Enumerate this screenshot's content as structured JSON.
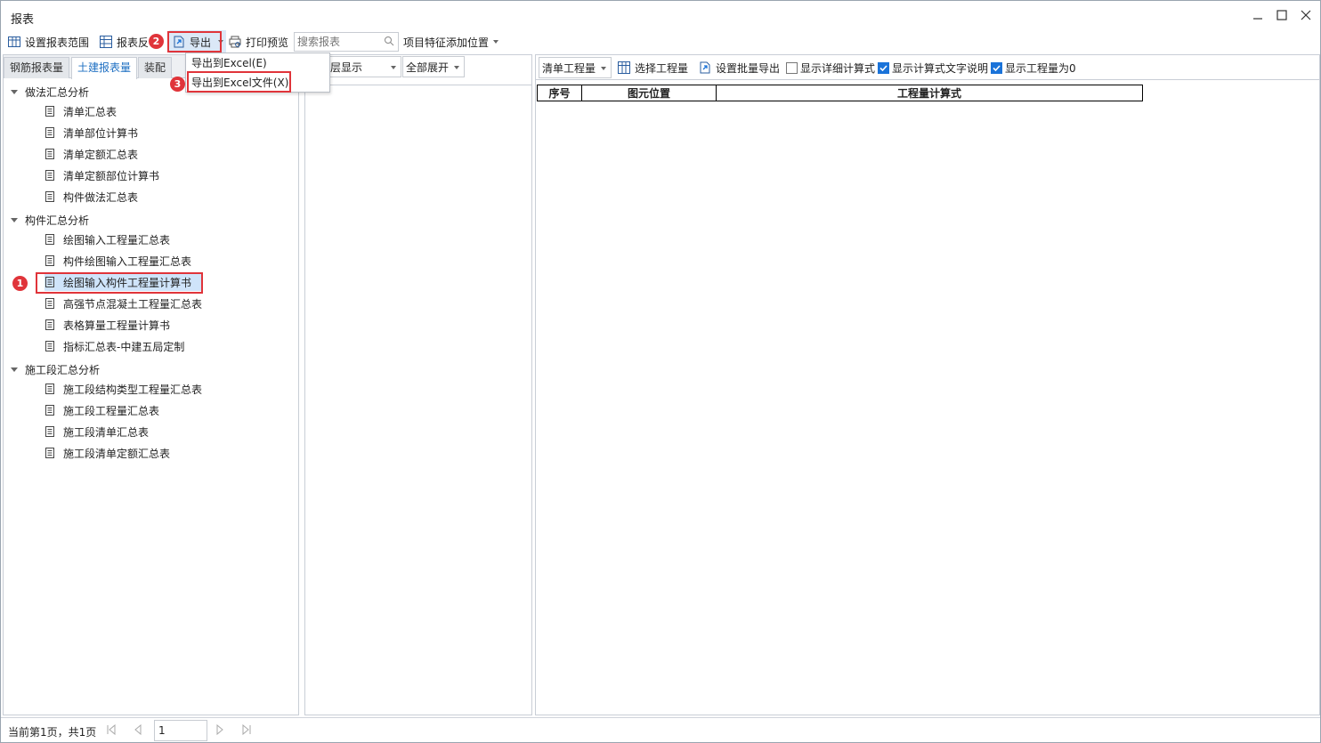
{
  "window": {
    "title": "报表"
  },
  "toolbar": {
    "set_range_label": "设置报表范围",
    "report_reverse_label": "报表反",
    "export_label": "导出",
    "print_preview_label": "打印预览",
    "search_placeholder": "搜索报表",
    "add_feature_label": "项目特征添加位置"
  },
  "export_menu": {
    "items": [
      "导出到Excel(E)",
      "导出到Excel文件(X)"
    ]
  },
  "badges": {
    "b1": "1",
    "b2": "2",
    "b3": "3"
  },
  "left_tabs": [
    "钢筋报表量",
    "土建报表量",
    "装配"
  ],
  "tree": {
    "groups": [
      {
        "label": "做法汇总分析",
        "items": [
          "清单汇总表",
          "清单部位计算书",
          "清单定额汇总表",
          "清单定额部位计算书",
          "构件做法汇总表"
        ]
      },
      {
        "label": "构件汇总分析",
        "items": [
          "绘图输入工程量汇总表",
          "构件绘图输入工程量汇总表",
          "绘图输入构件工程量计算书",
          "高强节点混凝土工程量汇总表",
          "表格算量工程量计算书",
          "指标汇总表-中建五局定制"
        ]
      },
      {
        "label": "施工段汇总分析",
        "items": [
          "施工段结构类型工程量汇总表",
          "施工段工程量汇总表",
          "施工段清单汇总表",
          "施工段清单定额汇总表"
        ]
      }
    ]
  },
  "middle": {
    "layer_combo": "层显示",
    "expand_combo": "全部展开"
  },
  "right_toolbar": {
    "qty_combo": "清单工程量",
    "select_qty_label": "选择工程量",
    "batch_export_label": "设置批量导出",
    "show_detail_label": "显示详细计算式",
    "show_detail_checked": false,
    "show_text_label": "显示计算式文字说明",
    "show_text_checked": true,
    "show_zero_label": "显示工程量为0",
    "show_zero_checked": true
  },
  "report_table": {
    "headers": [
      "序号",
      "图元位置",
      "工程量计算式"
    ]
  },
  "status": {
    "page_text": "当前第1页，共1页",
    "page_value": "1"
  },
  "colors": {
    "accent": "#1e6fc2",
    "highlight_red": "#e0343a",
    "selected_bg": "#cfe4fa",
    "checkbox_blue": "#1a73d9"
  }
}
